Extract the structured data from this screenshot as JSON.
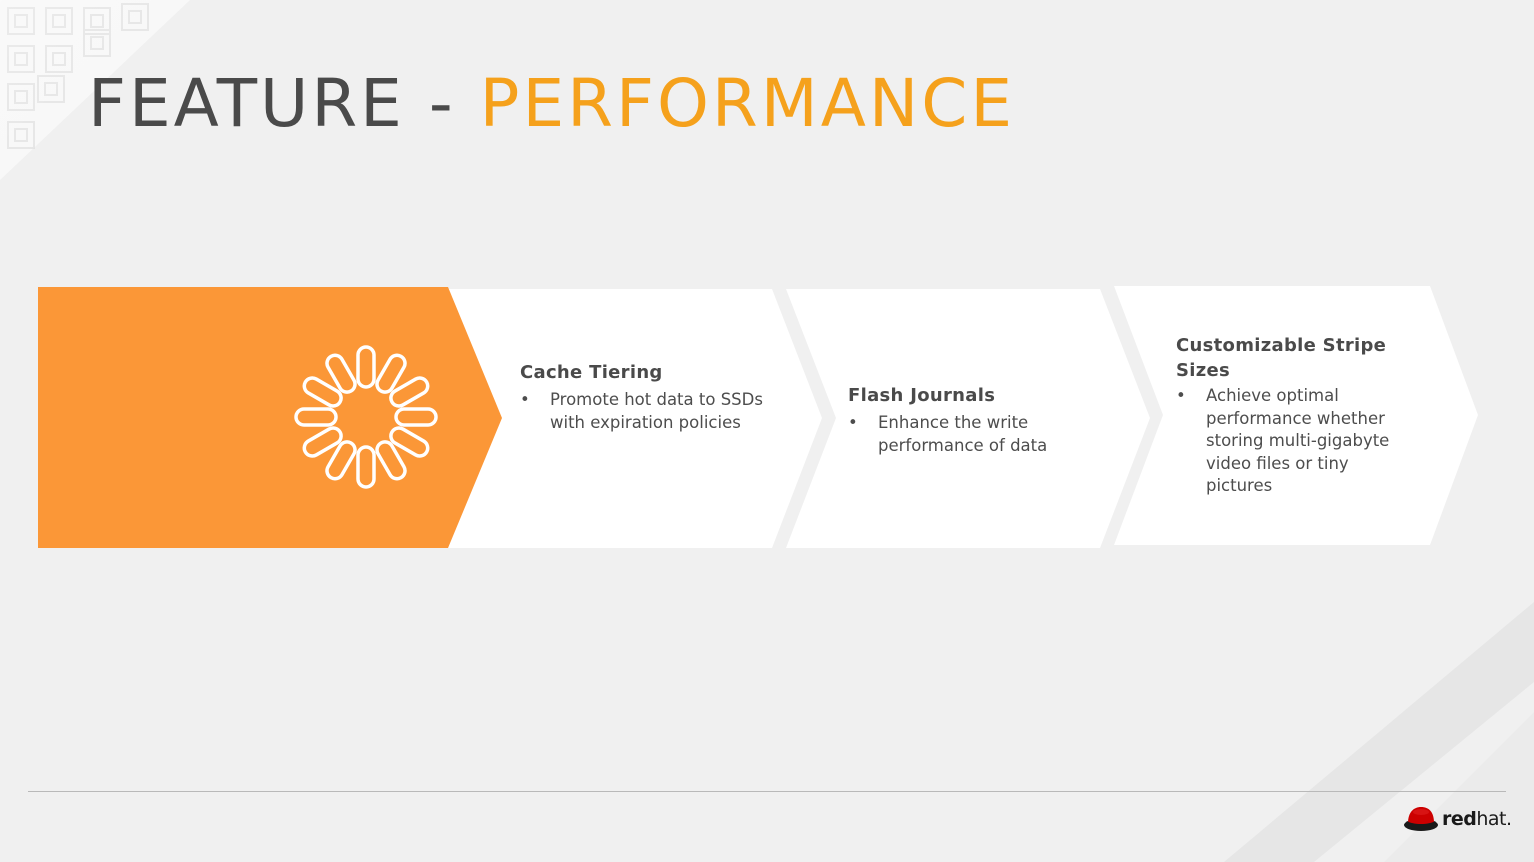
{
  "title": {
    "main": "FEATURE - ",
    "accent": "PERFORMANCE"
  },
  "colors": {
    "accent": "#f5a11c",
    "hero": "#fb9737",
    "panel": "#ffffff",
    "text": "#4a4a4a",
    "logo_red": "#cc0000"
  },
  "hero_icon": "spinner-icon",
  "steps": [
    {
      "heading": "Cache Tiering",
      "bullets": [
        "Promote hot data to SSDs with expiration policies"
      ]
    },
    {
      "heading": "Flash Journals",
      "bullets": [
        "Enhance the write performance of data"
      ]
    },
    {
      "heading": "Customizable Stripe Sizes",
      "bullets": [
        "Achieve optimal performance whether storing multi-gigabyte video files or tiny pictures"
      ]
    }
  ],
  "logo": {
    "icon": "red-hat-fedora-icon",
    "bold": "red",
    "light": "hat."
  },
  "bullet_glyph": "•"
}
